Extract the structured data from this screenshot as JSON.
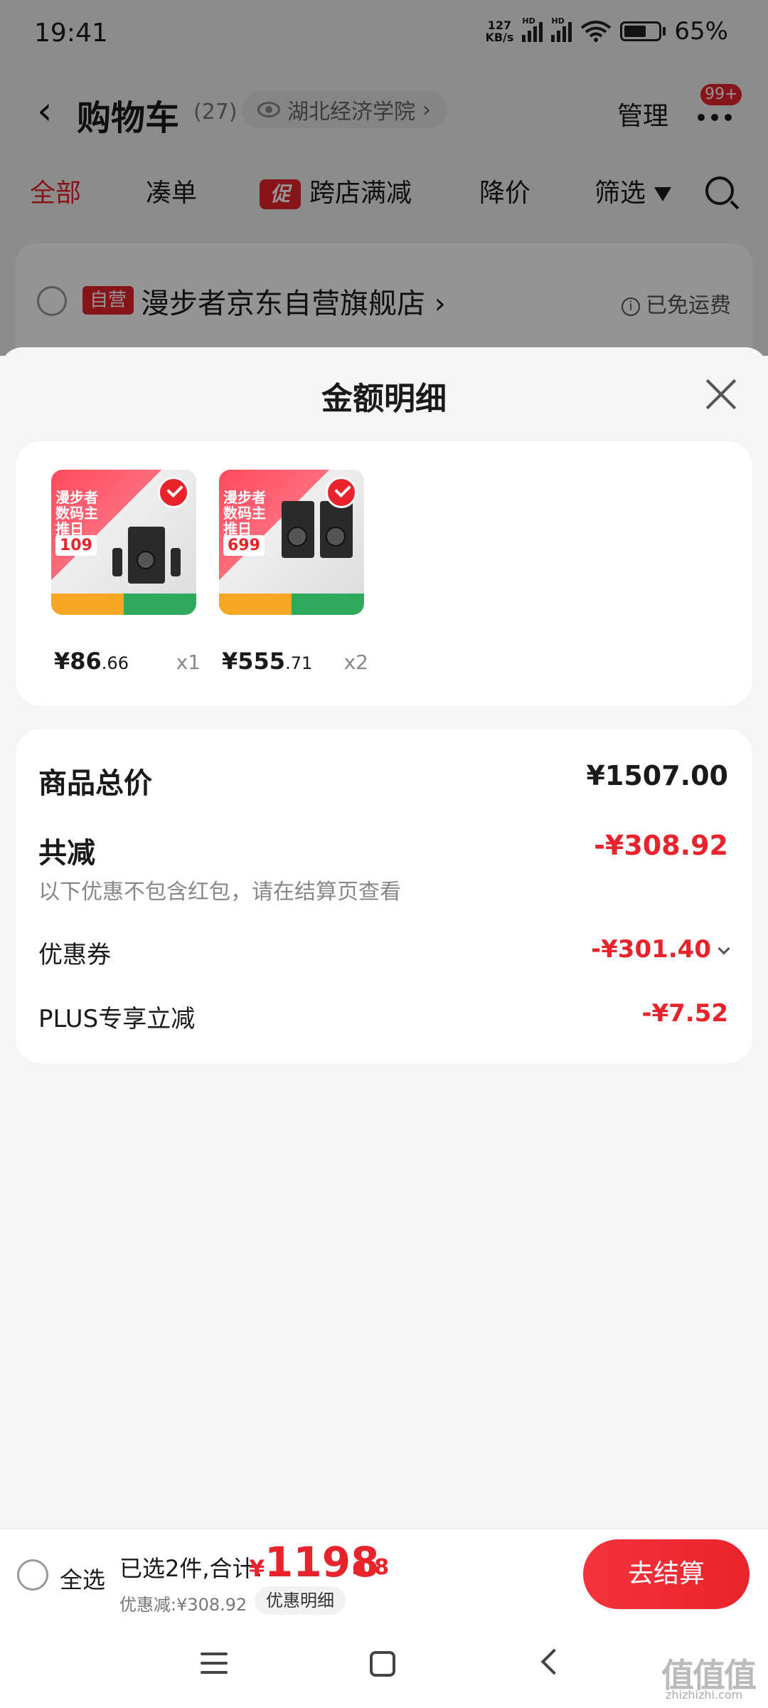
{
  "status_bar": {
    "time": "19:41",
    "net_speed_value": "127",
    "net_speed_unit": "KB/s",
    "signal_label": "HD",
    "battery": "65%"
  },
  "header": {
    "back_label": "‹",
    "title": "购物车",
    "count": "(27)",
    "location": "湖北经济学院",
    "location_chevron": "›",
    "manage": "管理",
    "more_badge": "99+"
  },
  "filters": {
    "all": "全部",
    "bundle": "凑单",
    "promo_tag": "促",
    "cross_store": "跨店满减",
    "price_drop": "降价",
    "filter": "筛选"
  },
  "store": {
    "self_tag": "自营",
    "name": "漫步者京东自营旗舰店",
    "chevron": "›",
    "shipping": "已免运费",
    "info_glyph": "i"
  },
  "sheet": {
    "title": "金额明细",
    "products": [
      {
        "price_main": "¥86",
        "price_small": ".66",
        "qty": "x1",
        "promo_title": "漫步者 数码主推日",
        "promo_price": "109"
      },
      {
        "price_main": "¥555",
        "price_small": ".71",
        "qty": "x2",
        "promo_title": "漫步者 数码主推日",
        "promo_price": "699"
      }
    ],
    "summary": {
      "total_label": "商品总价",
      "total_value": "¥1507.00",
      "reduce_label": "共减",
      "reduce_value": "-¥308.92",
      "note": "以下优惠不包含红包，请在结算页查看",
      "coupon_label": "优惠券",
      "coupon_value": "-¥301.40",
      "plus_label": "PLUS专享立减",
      "plus_value": "-¥7.52"
    }
  },
  "checkout": {
    "select_all": "全选",
    "selected_text": "已选2件,合计:",
    "total_yen": "¥",
    "total_int": "1198",
    "total_dec": ".08",
    "discount_text": "优惠减:¥308.92",
    "discount_detail": "优惠明细",
    "button": "去结算"
  },
  "watermark": {
    "main": "值值值",
    "sub": "zhizhizhi.com"
  },
  "colors": {
    "accent": "#e8232b",
    "sheet_bg": "#f5f5f5"
  },
  "icons": [
    "eye-icon",
    "more-icon",
    "funnel-icon",
    "search-icon",
    "close-icon",
    "check-icon",
    "chevron-down-icon",
    "menu-icon",
    "home-icon",
    "back-icon"
  ]
}
